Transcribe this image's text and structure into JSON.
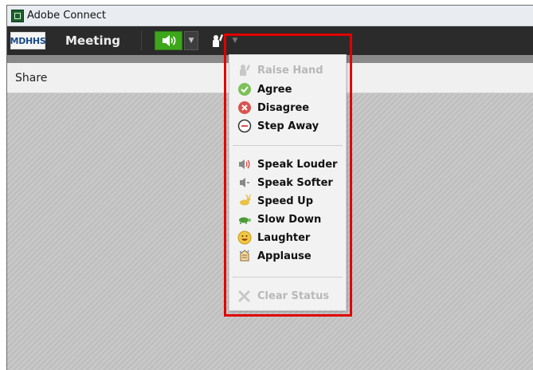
{
  "window": {
    "title": "Adobe Connect"
  },
  "toolbar": {
    "logo_text": "MDHHS",
    "meeting_label": "Meeting",
    "audio_icon": "speaker-icon",
    "status_icon": "raise-hand-status-icon"
  },
  "pod": {
    "title": "Share"
  },
  "status_menu": {
    "items": [
      {
        "label": "Raise Hand",
        "icon": "raise-hand-icon",
        "enabled": false
      },
      {
        "label": "Agree",
        "icon": "check-icon",
        "enabled": true
      },
      {
        "label": "Disagree",
        "icon": "x-circle-icon",
        "enabled": true
      },
      {
        "label": "Step Away",
        "icon": "minus-circle-icon",
        "enabled": true
      },
      {
        "label": "Speak Louder",
        "icon": "speaker-loud-icon",
        "enabled": true
      },
      {
        "label": "Speak Softer",
        "icon": "speaker-soft-icon",
        "enabled": true
      },
      {
        "label": "Speed Up",
        "icon": "rabbit-icon",
        "enabled": true
      },
      {
        "label": "Slow Down",
        "icon": "turtle-icon",
        "enabled": true
      },
      {
        "label": "Laughter",
        "icon": "smiley-icon",
        "enabled": true
      },
      {
        "label": "Applause",
        "icon": "applause-icon",
        "enabled": true
      },
      {
        "label": "Clear Status",
        "icon": "clear-x-icon",
        "enabled": false
      }
    ]
  },
  "colors": {
    "toolbar_bg": "#2b2b2b",
    "audio_green": "#3ea61a",
    "highlight_red": "#e00000"
  }
}
